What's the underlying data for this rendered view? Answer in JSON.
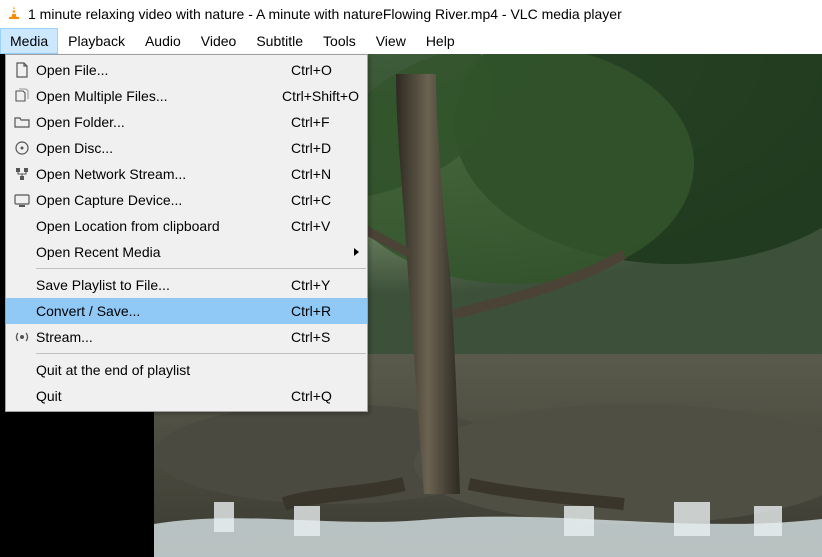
{
  "window": {
    "title": "1 minute relaxing video with nature - A minute with natureFlowing River.mp4 - VLC media player"
  },
  "menubar": {
    "items": [
      {
        "label": "Media",
        "open": true
      },
      {
        "label": "Playback"
      },
      {
        "label": "Audio"
      },
      {
        "label": "Video"
      },
      {
        "label": "Subtitle"
      },
      {
        "label": "Tools"
      },
      {
        "label": "View"
      },
      {
        "label": "Help"
      }
    ]
  },
  "media_menu": {
    "items": [
      {
        "icon": "file-icon",
        "label": "Open File...",
        "accel": "Ctrl+O"
      },
      {
        "icon": "files-icon",
        "label": "Open Multiple Files...",
        "accel": "Ctrl+Shift+O"
      },
      {
        "icon": "folder-icon",
        "label": "Open Folder...",
        "accel": "Ctrl+F"
      },
      {
        "icon": "disc-icon",
        "label": "Open Disc...",
        "accel": "Ctrl+D"
      },
      {
        "icon": "network-icon",
        "label": "Open Network Stream...",
        "accel": "Ctrl+N"
      },
      {
        "icon": "capture-icon",
        "label": "Open Capture Device...",
        "accel": "Ctrl+C"
      },
      {
        "icon": "",
        "label": "Open Location from clipboard",
        "accel": "Ctrl+V"
      },
      {
        "icon": "",
        "label": "Open Recent Media",
        "submenu": true
      },
      {
        "sep": true
      },
      {
        "icon": "",
        "label": "Save Playlist to File...",
        "accel": "Ctrl+Y"
      },
      {
        "icon": "",
        "label": "Convert / Save...",
        "accel": "Ctrl+R",
        "highlight": true
      },
      {
        "icon": "stream-icon",
        "label": "Stream...",
        "accel": "Ctrl+S"
      },
      {
        "sep": true
      },
      {
        "icon": "",
        "label": "Quit at the end of playlist"
      },
      {
        "icon": "",
        "label": "Quit",
        "accel": "Ctrl+Q"
      }
    ]
  }
}
